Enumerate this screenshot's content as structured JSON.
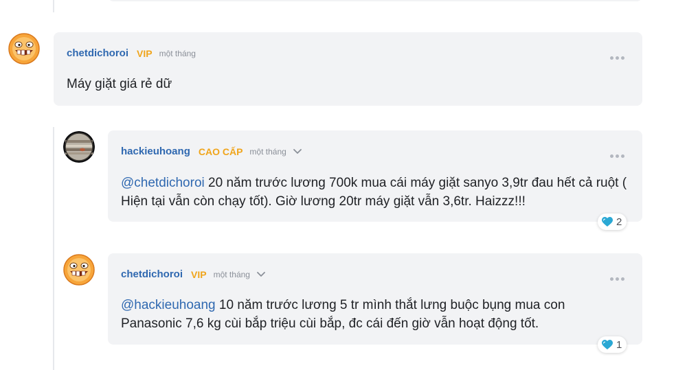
{
  "comments": [
    {
      "username": "chetdichoroi",
      "badge": "VIP",
      "time": "một tháng",
      "text": "Máy giặt giá rẻ dữ"
    },
    {
      "username": "hackieuhoang",
      "badge": "CAO CẤP",
      "time": "một tháng",
      "mention": "@chetdichoroi",
      "text": " 20 năm trước lương 700k mua cái máy giặt sanyo 3,9tr đau hết cả ruột ( Hiện tại vẫn còn chạy tốt). Giờ lương 20tr máy giặt vẫn 3,6tr. Haizzz!!!",
      "reaction_count": "2"
    },
    {
      "username": "chetdichoroi",
      "badge": "VIP",
      "time": "một tháng",
      "mention": "@hackieuhoang",
      "text": " 10 năm trước lương 5 tr mình thắt lưng buộc bụng mua con Panasonic 7,6 kg cùi bắp triệu cùi bắp, đc cái đến giờ vẫn hoạt động tốt.",
      "reaction_count": "1"
    }
  ],
  "colors": {
    "username": "#2f68b0",
    "badge": "#f0a51c",
    "card_bg": "#f2f3f5",
    "reaction_heart": "#2aa8d4"
  },
  "icons": [
    "emoji-avatar-icon",
    "planet-avatar-icon",
    "more-options-icon",
    "chevron-down-icon",
    "heart-reaction-icon"
  ]
}
